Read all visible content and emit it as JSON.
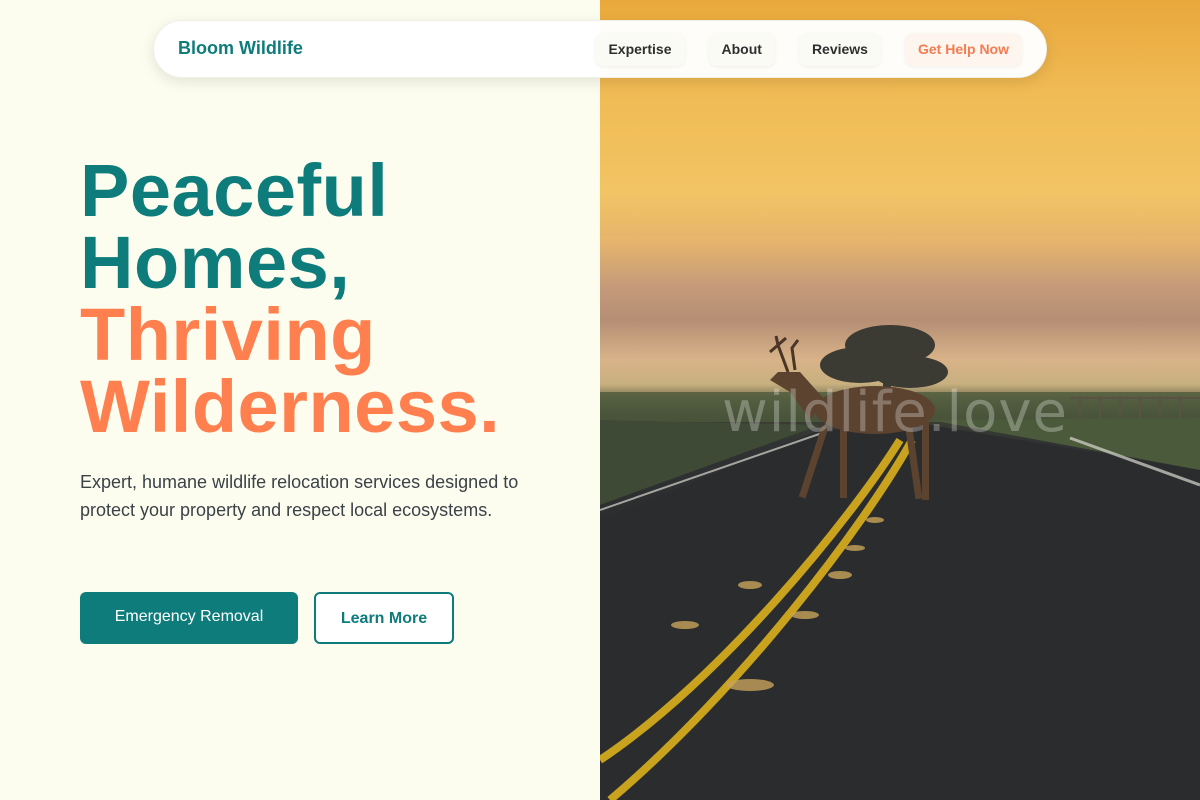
{
  "nav": {
    "brand": "Bloom Wildlife",
    "links": [
      {
        "label": "Expertise"
      },
      {
        "label": "About"
      },
      {
        "label": "Reviews"
      },
      {
        "label": "Get Help Now"
      }
    ]
  },
  "hero": {
    "headline_line1": "Peaceful",
    "headline_line2": "Homes,",
    "headline_line3": "Thriving",
    "headline_line4": "Wilderness.",
    "subtext": "Expert, humane wildlife relocation services designed to protect your property and respect local ecosystems.",
    "primary_button": "Emergency Removal",
    "secondary_button": "Learn More"
  },
  "image": {
    "watermark": "wildlife.love"
  },
  "colors": {
    "brand_teal": "#0e7c7b",
    "accent_orange": "#ff7f4f",
    "background": "#fdfdef"
  }
}
